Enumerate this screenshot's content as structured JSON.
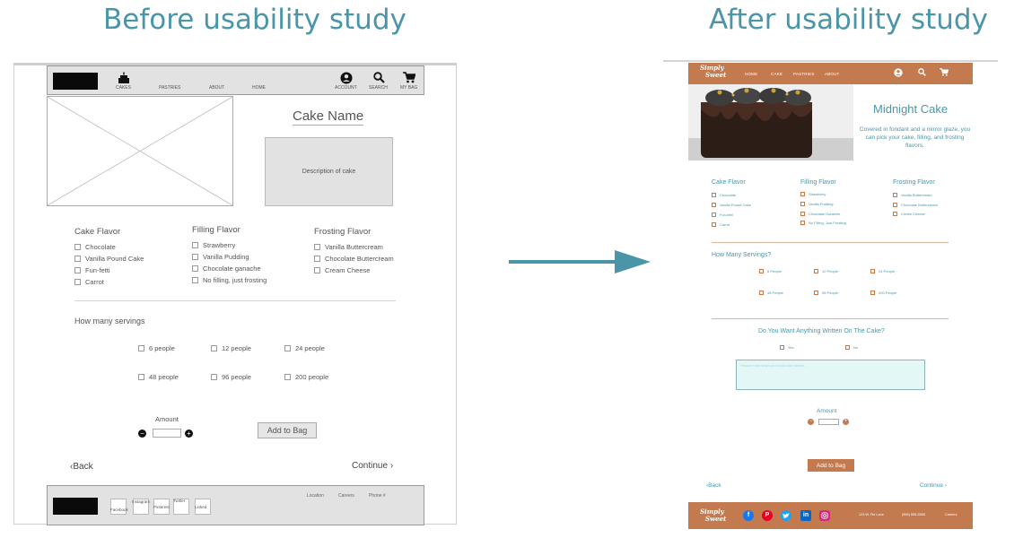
{
  "headings": {
    "before": "Before usability study",
    "after": "After usability study"
  },
  "before": {
    "nav": {
      "items": [
        "CAKES",
        "PASTRIES",
        "ABOUT",
        "HOME"
      ],
      "right": [
        "ACCOUNT",
        "SEARCH",
        "MY BAG"
      ]
    },
    "title": "Cake Name",
    "description": "Description of cake",
    "columns": [
      {
        "heading": "Cake Flavor",
        "options": [
          "Chocolate",
          "Vanilla Pound Cake",
          "Fun-fetti",
          "Carrot"
        ]
      },
      {
        "heading": "Filling Flavor",
        "options": [
          "Strawberry",
          "Vanilla Pudding",
          "Chocolate ganache",
          "No filling, just frosting"
        ]
      },
      {
        "heading": "Frosting Flavor",
        "options": [
          "Vanilla Buttercream",
          "Chocolate Buttercream",
          "Cream Cheese"
        ]
      }
    ],
    "servings_label": "How many servings",
    "servings": [
      "6 people",
      "12 people",
      "24 people",
      "48 people",
      "96 people",
      "200 people"
    ],
    "amount_label": "Amount",
    "add_to_bag": "Add to Bag",
    "back": "Back",
    "continue": "Continue",
    "footer": {
      "social": [
        "Facebook",
        "Instagram",
        "Pinterest",
        "Twitter",
        "Linked"
      ],
      "links": [
        "Location",
        "Careers",
        "Phone #"
      ]
    }
  },
  "after": {
    "logo_line1": "Simply",
    "logo_line2": "Sweet",
    "nav": {
      "items": [
        "HOME",
        "CAKE",
        "PASTRIES",
        "ABOUT"
      ]
    },
    "title": "Midnight Cake",
    "description": "Covered in fondant and a mirror glaze, you can pick your cake, filling, and frosting flavors.",
    "columns": [
      {
        "heading": "Cake Flavor",
        "options": [
          "Chocolate",
          "Vanilla Pound Cake",
          "Fun-fetti",
          "Carrot"
        ]
      },
      {
        "heading": "Filling Flavor",
        "options": [
          "Strawberry",
          "Vanilla Pudding",
          "Chocolate Ganache",
          "No Filling, Just Frosting"
        ]
      },
      {
        "heading": "Frosting Flavor",
        "options": [
          "Vanilla Buttercream",
          "Chocolate Buttercream",
          "Cream Cheese"
        ]
      }
    ],
    "servings_label": "How Many Servings?",
    "servings": [
      "6 People",
      "12 People",
      "24 People",
      "48 People",
      "96 People",
      "200 People"
    ],
    "written_label": "Do You Want Anything Written On The Cake?",
    "written_options": [
      "Yes",
      "No"
    ],
    "placeholder": "Please enter what you would like written...",
    "amount_label": "Amount",
    "add_to_bag": "Add to Bag",
    "back": "Back",
    "continue": "Continue",
    "footer": {
      "links": [
        "123 W. Pie Lane",
        "(555) 555-5555",
        "Careers"
      ]
    }
  },
  "colors": {
    "accent": "#4a96a8",
    "brand": "#c37a4f",
    "wireframe_gray": "#e2e2e2"
  }
}
